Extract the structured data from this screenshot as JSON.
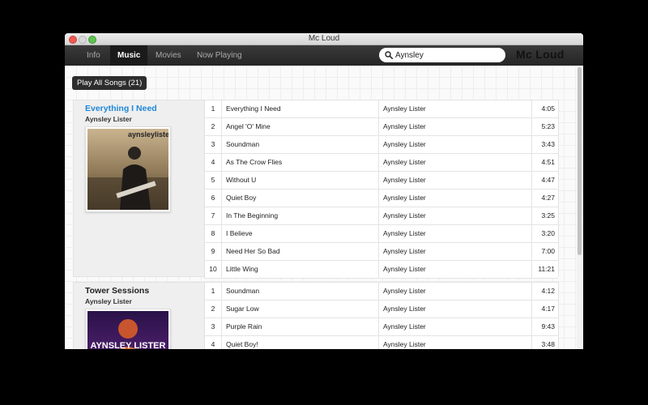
{
  "window": {
    "title": "Mc Loud"
  },
  "nav": {
    "tabs": [
      {
        "label": "Info",
        "active": false
      },
      {
        "label": "Music",
        "active": true
      },
      {
        "label": "Movies",
        "active": false
      },
      {
        "label": "Now Playing",
        "active": false
      }
    ],
    "search_value": "Aynsley",
    "search_icon": "search-icon",
    "brand": "Mc Loud"
  },
  "main": {
    "play_all_label": "Play All Songs (21)",
    "albums": [
      {
        "title": "Everything I Need",
        "artist": "Aynsley Lister",
        "cover_text": "aynsleylister",
        "tracks": [
          {
            "num": "1",
            "name": "Everything I Need",
            "artist": "Aynsley Lister",
            "time": "4:05"
          },
          {
            "num": "2",
            "name": "Angel 'O' Mine",
            "artist": "Aynsley Lister",
            "time": "5:23"
          },
          {
            "num": "3",
            "name": "Soundman",
            "artist": "Aynsley Lister",
            "time": "3:43"
          },
          {
            "num": "4",
            "name": "As The Crow Flies",
            "artist": "Aynsley Lister",
            "time": "4:51"
          },
          {
            "num": "5",
            "name": "Without U",
            "artist": "Aynsley Lister",
            "time": "4:47"
          },
          {
            "num": "6",
            "name": "Quiet Boy",
            "artist": "Aynsley Lister",
            "time": "4:27"
          },
          {
            "num": "7",
            "name": "In The Beginning",
            "artist": "Aynsley Lister",
            "time": "3:25"
          },
          {
            "num": "8",
            "name": "I Believe",
            "artist": "Aynsley Lister",
            "time": "3:20"
          },
          {
            "num": "9",
            "name": "Need Her So Bad",
            "artist": "Aynsley Lister",
            "time": "7:00"
          },
          {
            "num": "10",
            "name": "Little Wing",
            "artist": "Aynsley Lister",
            "time": "11:21"
          }
        ]
      },
      {
        "title": "Tower Sessions",
        "artist": "Aynsley Lister",
        "cover_text": "AYNSLEY LISTER",
        "tracks": [
          {
            "num": "1",
            "name": "Soundman",
            "artist": "Aynsley Lister",
            "time": "4:12"
          },
          {
            "num": "2",
            "name": "Sugar Low",
            "artist": "Aynsley Lister",
            "time": "4:17"
          },
          {
            "num": "3",
            "name": "Purple Rain",
            "artist": "Aynsley Lister",
            "time": "9:43"
          },
          {
            "num": "4",
            "name": "Quiet Boy!",
            "artist": "Aynsley Lister",
            "time": "3:48"
          }
        ]
      }
    ]
  }
}
